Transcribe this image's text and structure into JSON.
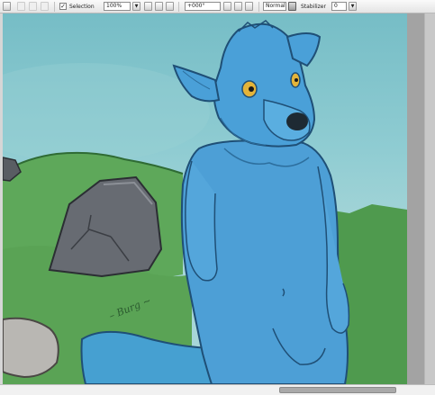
{
  "toolbar": {
    "selection_checked": true,
    "selection_label": "Selection",
    "zoom_value": "100%",
    "angle_value": "+000°",
    "blend_mode": "Normal",
    "stabilizer_label": "Stabilizer",
    "stabilizer_value": "0"
  },
  "canvas": {
    "signature_text": "– Burg ~",
    "colors": {
      "sky": "#7dc2ca",
      "grass": "#62a65a",
      "rock": "#62666d",
      "wolf_fur": "#4d9fd6",
      "wolf_outline": "#1f4f76",
      "eyes": "#e3b43a"
    }
  },
  "icons": {
    "tool_a": "square-icon",
    "tool_b": "square-icon",
    "tool_c": "square-icon",
    "zoom_dropdown": "dropdown-arrow-icon",
    "zoom_out": "zoom-out-icon",
    "zoom_in": "zoom-in-icon",
    "fit": "fit-window-icon",
    "rotate_ccw": "rotate-left-icon",
    "rotate_cw": "rotate-right-icon",
    "rotate_reset": "rotate-reset-icon",
    "blend_dropdown": "dropdown-arrow-icon"
  }
}
